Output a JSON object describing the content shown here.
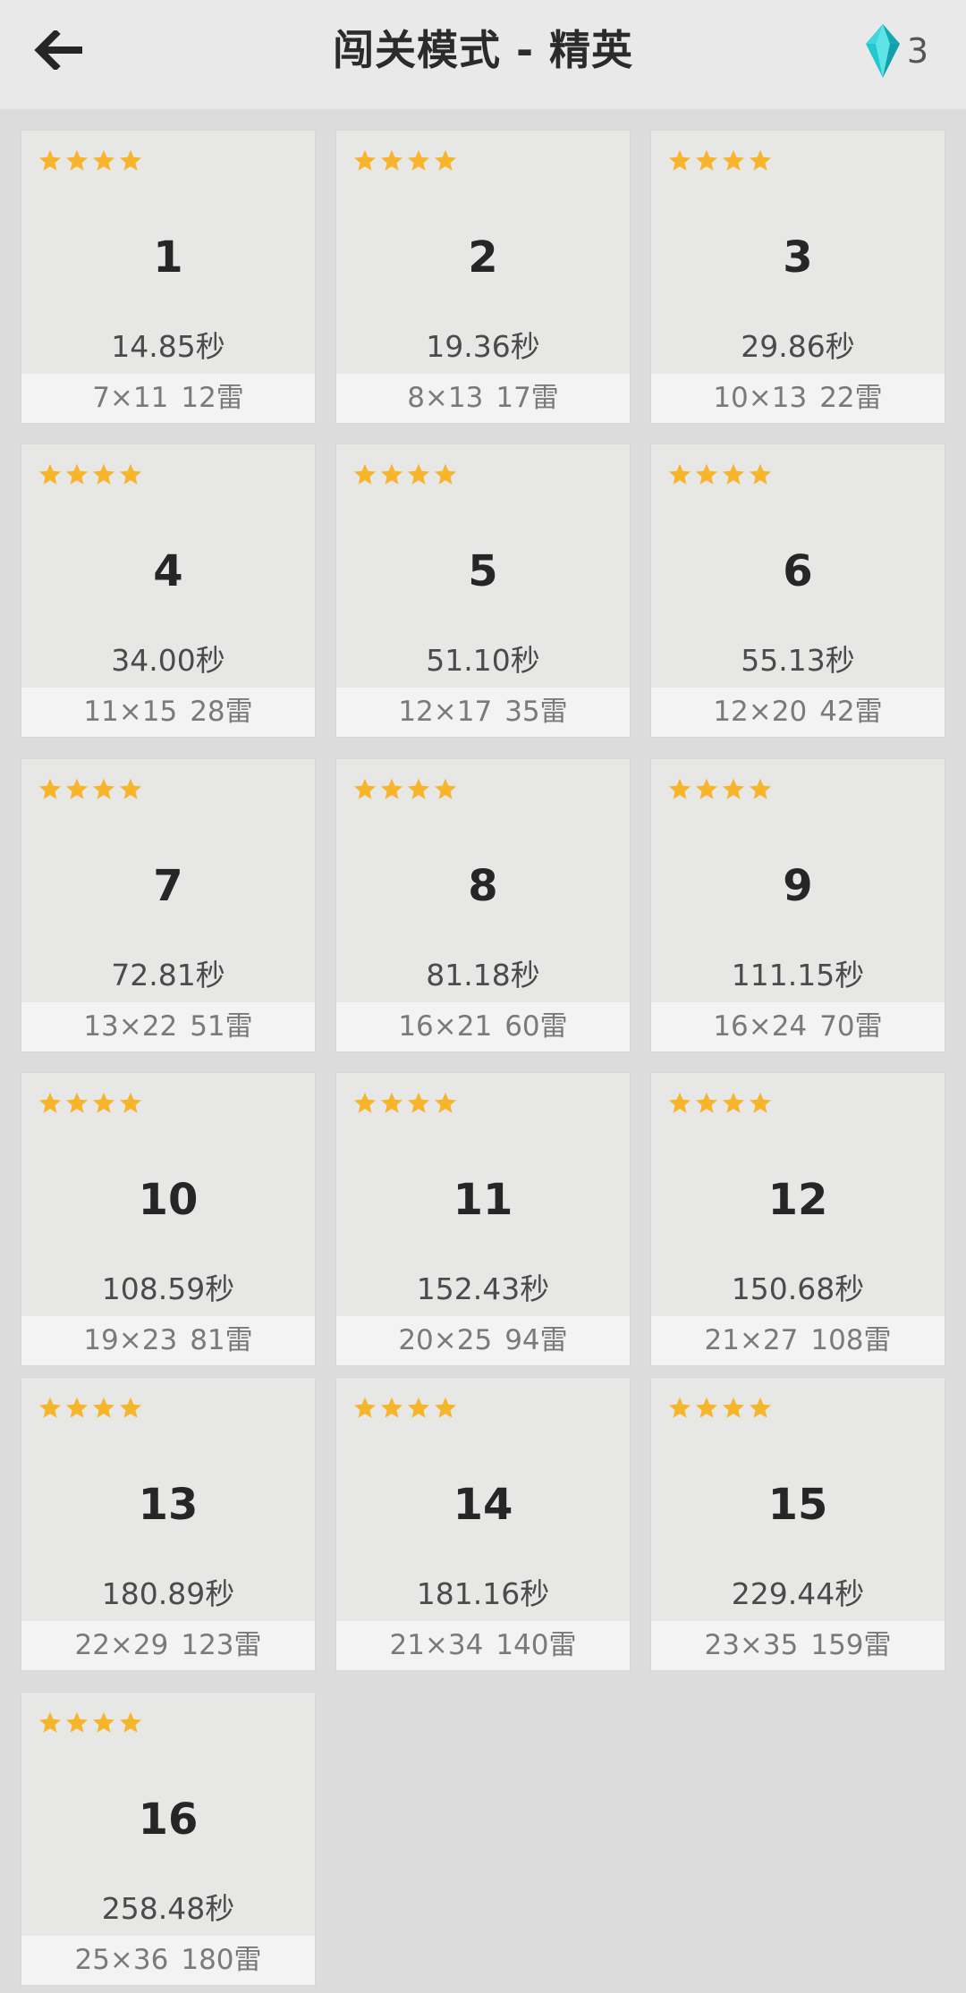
{
  "header": {
    "title": "闯关模式 - 精英",
    "gem_count": "3",
    "back_icon": "arrow-left-icon",
    "gem_icon": "diamond-gem-icon"
  },
  "colors": {
    "background": "#dcdcdc",
    "header_bg": "#e9e9e9",
    "card_bg": "#e7e7e6",
    "detail_bg": "#f3f3f3",
    "star": "#f7b52c",
    "gem": "#22c7cf"
  },
  "levels": [
    {
      "number": "1",
      "stars": 4,
      "time": "14.85秒",
      "size": "7×11",
      "mines": "12雷"
    },
    {
      "number": "2",
      "stars": 4,
      "time": "19.36秒",
      "size": "8×13",
      "mines": "17雷"
    },
    {
      "number": "3",
      "stars": 4,
      "time": "29.86秒",
      "size": "10×13",
      "mines": "22雷"
    },
    {
      "number": "4",
      "stars": 4,
      "time": "34.00秒",
      "size": "11×15",
      "mines": "28雷"
    },
    {
      "number": "5",
      "stars": 4,
      "time": "51.10秒",
      "size": "12×17",
      "mines": "35雷"
    },
    {
      "number": "6",
      "stars": 4,
      "time": "55.13秒",
      "size": "12×20",
      "mines": "42雷"
    },
    {
      "number": "7",
      "stars": 4,
      "time": "72.81秒",
      "size": "13×22",
      "mines": "51雷"
    },
    {
      "number": "8",
      "stars": 4,
      "time": "81.18秒",
      "size": "16×21",
      "mines": "60雷"
    },
    {
      "number": "9",
      "stars": 4,
      "time": "111.15秒",
      "size": "16×24",
      "mines": "70雷"
    },
    {
      "number": "10",
      "stars": 4,
      "time": "108.59秒",
      "size": "19×23",
      "mines": "81雷"
    },
    {
      "number": "11",
      "stars": 4,
      "time": "152.43秒",
      "size": "20×25",
      "mines": "94雷"
    },
    {
      "number": "12",
      "stars": 4,
      "time": "150.68秒",
      "size": "21×27",
      "mines": "108雷"
    },
    {
      "number": "13",
      "stars": 4,
      "time": "180.89秒",
      "size": "22×29",
      "mines": "123雷"
    },
    {
      "number": "14",
      "stars": 4,
      "time": "181.16秒",
      "size": "21×34",
      "mines": "140雷"
    },
    {
      "number": "15",
      "stars": 4,
      "time": "229.44秒",
      "size": "23×35",
      "mines": "159雷"
    },
    {
      "number": "16",
      "stars": 4,
      "time": "258.48秒",
      "size": "25×36",
      "mines": "180雷"
    }
  ]
}
